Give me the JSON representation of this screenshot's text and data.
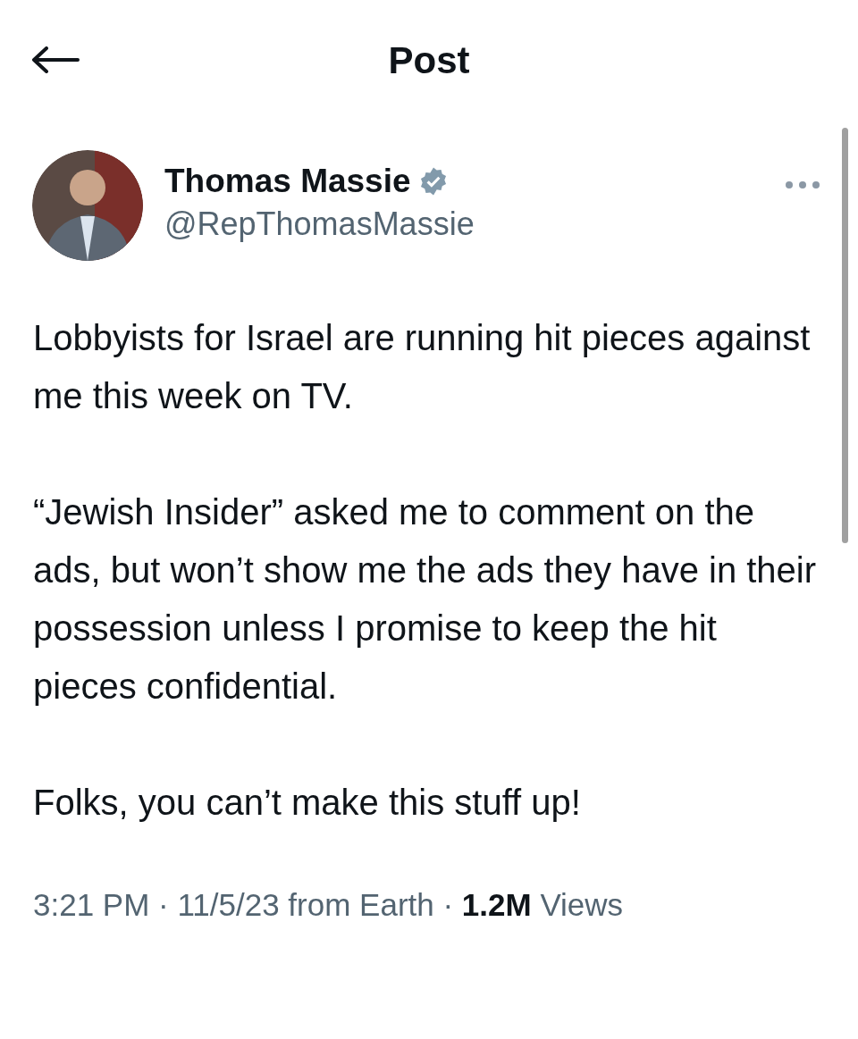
{
  "header": {
    "title": "Post"
  },
  "post": {
    "author": {
      "name": "Thomas Massie",
      "verified": true,
      "handle": "@RepThomasMassie"
    },
    "paragraphs": [
      "Lobbyists for Israel are running hit pieces against me this week on TV.",
      "“Jewish Insider” asked me to comment on the ads, but won’t show me the ads they have in their possession unless I promise to keep the hit pieces confidential.",
      "Folks, you can’t make this stuff up!"
    ],
    "meta": "3:21 PM · 11/5/23 from Earth · **1.2M** Views"
  }
}
